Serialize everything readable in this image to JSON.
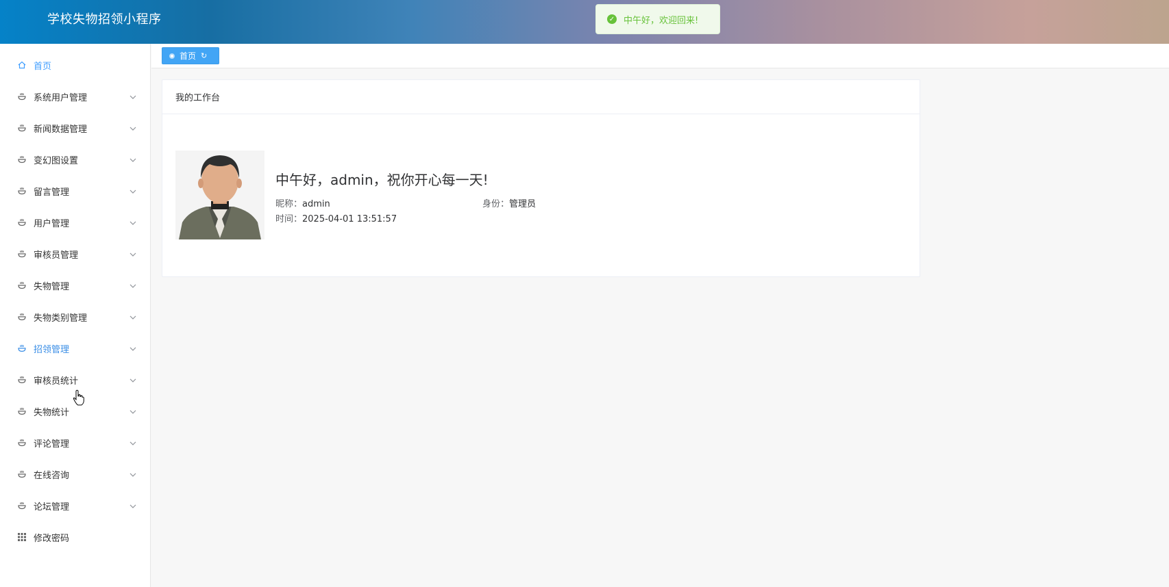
{
  "header": {
    "title": "学校失物招领小程序"
  },
  "toast": {
    "message": "中午好，欢迎回来!"
  },
  "sidebar": {
    "items": [
      {
        "label": "首页",
        "icon": "home-icon",
        "has_arrow": false,
        "state": "active"
      },
      {
        "label": "系统用户管理",
        "icon": "menu-bowl-icon",
        "has_arrow": true,
        "state": "normal"
      },
      {
        "label": "新闻数据管理",
        "icon": "menu-bowl-icon",
        "has_arrow": true,
        "state": "normal"
      },
      {
        "label": "变幻图设置",
        "icon": "menu-bowl-icon",
        "has_arrow": true,
        "state": "normal"
      },
      {
        "label": "留言管理",
        "icon": "menu-bowl-icon",
        "has_arrow": true,
        "state": "normal"
      },
      {
        "label": "用户管理",
        "icon": "menu-bowl-icon",
        "has_arrow": true,
        "state": "normal"
      },
      {
        "label": "审核员管理",
        "icon": "menu-bowl-icon",
        "has_arrow": true,
        "state": "normal"
      },
      {
        "label": "失物管理",
        "icon": "menu-bowl-icon",
        "has_arrow": true,
        "state": "normal"
      },
      {
        "label": "失物类别管理",
        "icon": "menu-bowl-icon",
        "has_arrow": true,
        "state": "normal"
      },
      {
        "label": "招领管理",
        "icon": "menu-bowl-icon",
        "has_arrow": true,
        "state": "hover"
      },
      {
        "label": "审核员统计",
        "icon": "menu-bowl-icon",
        "has_arrow": true,
        "state": "normal"
      },
      {
        "label": "失物统计",
        "icon": "menu-bowl-icon",
        "has_arrow": true,
        "state": "normal"
      },
      {
        "label": "评论管理",
        "icon": "menu-bowl-icon",
        "has_arrow": true,
        "state": "normal"
      },
      {
        "label": "在线咨询",
        "icon": "menu-bowl-icon",
        "has_arrow": true,
        "state": "normal"
      },
      {
        "label": "论坛管理",
        "icon": "menu-bowl-icon",
        "has_arrow": true,
        "state": "normal"
      },
      {
        "label": "修改密码",
        "icon": "grid-icon",
        "has_arrow": false,
        "state": "normal"
      }
    ]
  },
  "tabs": {
    "home_label": "首页"
  },
  "workbench": {
    "title": "我的工作台",
    "greeting": "中午好，admin，祝你开心每一天!",
    "nickname_label": "昵称：",
    "nickname_value": "admin",
    "role_label": "身份：",
    "role_value": "管理员",
    "time_label": "时间：",
    "time_value": "2025-04-01 13:51:57"
  },
  "colors": {
    "accent": "#409eff",
    "toast_success": "#67c23a",
    "toast_bg": "#f0f9eb"
  }
}
